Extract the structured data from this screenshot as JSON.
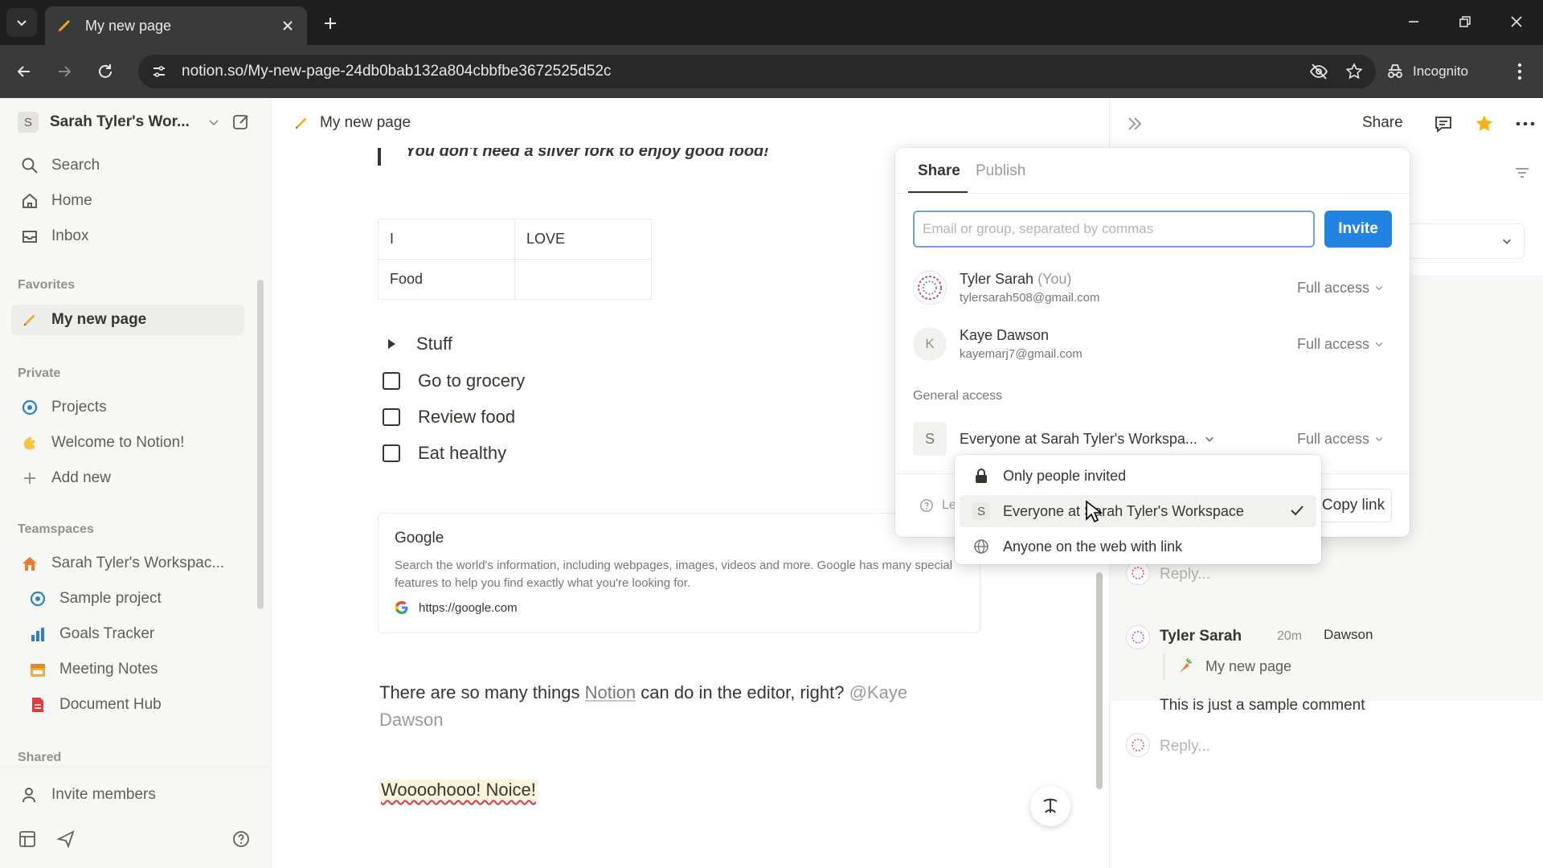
{
  "browser": {
    "tab_title": "My new page",
    "url": "notion.so/My-new-page-24db0bab132a804cbbfbe3672525d52c",
    "incognito_label": "Incognito"
  },
  "sidebar": {
    "workspace_name": "Sarah Tyler's Wor...",
    "workspace_initial": "S",
    "nav": [
      {
        "label": "Search",
        "icon": "search-icon"
      },
      {
        "label": "Home",
        "icon": "home-icon"
      },
      {
        "label": "Inbox",
        "icon": "inbox-icon"
      }
    ],
    "favorites_title": "Favorites",
    "favorites": [
      {
        "label": "My new page",
        "icon": "pencil-icon"
      }
    ],
    "private_title": "Private",
    "private": [
      {
        "label": "Projects",
        "icon": "target-icon"
      },
      {
        "label": "Welcome to Notion!",
        "icon": "wave-icon"
      },
      {
        "label": "Add new",
        "icon": "plus-icon"
      }
    ],
    "teamspaces_title": "Teamspaces",
    "teamspaces": [
      {
        "label": "Sarah Tyler's Workspac...",
        "icon": "house-icon"
      },
      {
        "label": "Sample project",
        "icon": "target-icon"
      },
      {
        "label": "Goals Tracker",
        "icon": "chart-icon"
      },
      {
        "label": "Meeting Notes",
        "icon": "calendar-icon"
      },
      {
        "label": "Document Hub",
        "icon": "document-icon"
      }
    ],
    "shared_title": "Shared",
    "invite_members": "Invite members"
  },
  "page": {
    "breadcrumb": "My new page",
    "quote": "You don't need a silver fork to enjoy good food!",
    "table": [
      [
        "I",
        "LOVE"
      ],
      [
        "Food",
        ""
      ]
    ],
    "toggle_label": "Stuff",
    "todos": [
      {
        "label": "Go to grocery",
        "checked": false
      },
      {
        "label": "Review food",
        "checked": false
      },
      {
        "label": "Eat healthy",
        "checked": false
      }
    ],
    "bookmark": {
      "title": "Google",
      "description": "Search the world's information, including webpages, images, videos and more. Google has many special features to help you find exactly what you're looking for.",
      "url": "https://google.com"
    },
    "paragraph_before": "There are so many things ",
    "paragraph_link": "Notion",
    "paragraph_after": " can do in the editor, right? ",
    "paragraph_mention": "@Kaye Dawson",
    "highlight_text": "Woooohooo! Noice!"
  },
  "topbar": {
    "share_label": "Share"
  },
  "share_popover": {
    "tab_share": "Share",
    "tab_publish": "Publish",
    "input_placeholder": "Email or group, separated by commas",
    "invite_label": "Invite",
    "members": [
      {
        "name": "Tyler Sarah",
        "you_tag": "(You)",
        "email": "tylersarah508@gmail.com",
        "access": "Full access"
      },
      {
        "name": "Kaye Dawson",
        "initial": "K",
        "email": "kayemarj7@gmail.com",
        "access": "Full access"
      }
    ],
    "general_access_title": "General access",
    "general_access_value": "Everyone at Sarah Tyler's Workspa...",
    "general_access_level": "Full access",
    "learn_label": "Le",
    "copy_link_label": "Copy link"
  },
  "access_menu": {
    "items": [
      {
        "label": "Only people invited",
        "icon": "lock-icon",
        "selected": false
      },
      {
        "label": "Everyone at Sarah Tyler's Workspace",
        "icon": "workspace-icon",
        "initial": "S",
        "selected": true
      },
      {
        "label": "Anyone on the web with link",
        "icon": "globe-icon",
        "selected": false
      }
    ]
  },
  "comments": {
    "ghost_name": "Dawson",
    "reply_placeholder": "Reply...",
    "thread": {
      "author": "Tyler Sarah",
      "time": "20m",
      "page_ref": "My new page",
      "text": "This is just a sample comment"
    }
  },
  "colors": {
    "accent_blue": "#2383e2",
    "sidebar_bg": "#f7f7f5",
    "text_primary": "#37352f",
    "highlight_yellow": "#fbf3db"
  }
}
